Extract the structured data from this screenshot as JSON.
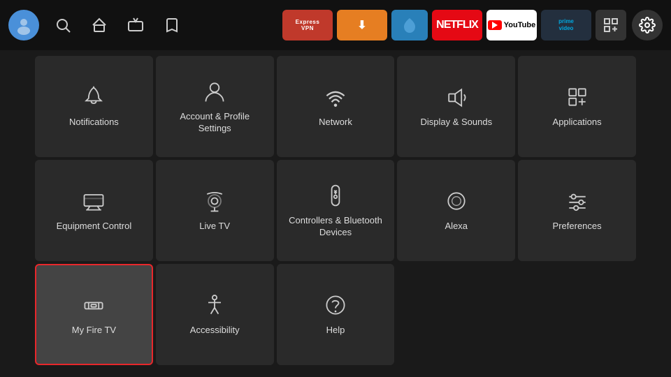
{
  "nav": {
    "avatar_icon": "👤",
    "search_label": "Search",
    "home_label": "Home",
    "live_label": "Live",
    "watchlist_label": "Watchlist",
    "settings_label": "Settings",
    "apps": [
      {
        "id": "expressvpn",
        "label": "ExpressVPN",
        "type": "expressvpn"
      },
      {
        "id": "downloader",
        "label": "Downloader",
        "type": "downloader"
      },
      {
        "id": "blue",
        "label": "App",
        "type": "blue"
      },
      {
        "id": "netflix",
        "label": "NETFLIX",
        "type": "netflix"
      },
      {
        "id": "youtube",
        "label": "YouTube",
        "type": "youtube"
      },
      {
        "id": "primevideo",
        "label": "prime video",
        "type": "primevideo"
      },
      {
        "id": "grid",
        "label": "Grid",
        "type": "grid"
      }
    ]
  },
  "settings": {
    "tiles": [
      {
        "id": "notifications",
        "label": "Notifications",
        "icon": "bell",
        "selected": false
      },
      {
        "id": "account",
        "label": "Account & Profile Settings",
        "icon": "person",
        "selected": false
      },
      {
        "id": "network",
        "label": "Network",
        "icon": "wifi",
        "selected": false
      },
      {
        "id": "display-sounds",
        "label": "Display & Sounds",
        "icon": "speaker",
        "selected": false
      },
      {
        "id": "applications",
        "label": "Applications",
        "icon": "apps",
        "selected": false
      },
      {
        "id": "equipment-control",
        "label": "Equipment Control",
        "icon": "tv",
        "selected": false
      },
      {
        "id": "live-tv",
        "label": "Live TV",
        "icon": "antenna",
        "selected": false
      },
      {
        "id": "controllers-bluetooth",
        "label": "Controllers & Bluetooth Devices",
        "icon": "remote",
        "selected": false
      },
      {
        "id": "alexa",
        "label": "Alexa",
        "icon": "alexa",
        "selected": false
      },
      {
        "id": "preferences",
        "label": "Preferences",
        "icon": "sliders",
        "selected": false
      },
      {
        "id": "my-fire-tv",
        "label": "My Fire TV",
        "icon": "firetv",
        "selected": true
      },
      {
        "id": "accessibility",
        "label": "Accessibility",
        "icon": "accessibility",
        "selected": false
      },
      {
        "id": "help",
        "label": "Help",
        "icon": "help",
        "selected": false
      }
    ]
  }
}
